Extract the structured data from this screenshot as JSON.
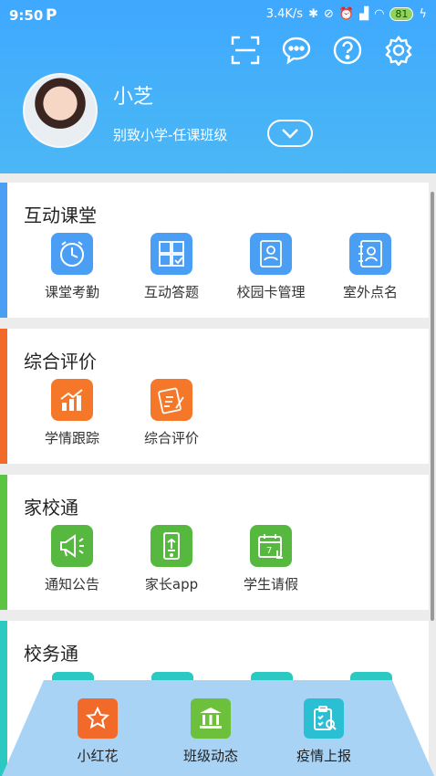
{
  "status": {
    "time": "9:50",
    "p_icon": "P",
    "net_speed": "3.4K/s",
    "battery": "81"
  },
  "header": {
    "icons": [
      "scan-icon",
      "message-icon",
      "help-icon",
      "settings-icon"
    ],
    "user_name": "小芝",
    "school_class": "别致小学-任课班级"
  },
  "sections": [
    {
      "title": "互动课堂",
      "accent": "#4a9ff5",
      "items": [
        {
          "label": "课堂考勤",
          "icon": "clock-icon",
          "color": "#4a9ff5"
        },
        {
          "label": "互动答题",
          "icon": "quiz-icon",
          "color": "#4a9ff5"
        },
        {
          "label": "校园卡管理",
          "icon": "id-card-icon",
          "color": "#4a9ff5"
        },
        {
          "label": "室外点名",
          "icon": "contact-book-icon",
          "color": "#4a9ff5"
        }
      ]
    },
    {
      "title": "综合评价",
      "accent": "#f26a2a",
      "items": [
        {
          "label": "学情跟踪",
          "icon": "chart-icon",
          "color": "#f5782a"
        },
        {
          "label": "综合评价",
          "icon": "evaluation-icon",
          "color": "#f5782a"
        }
      ]
    },
    {
      "title": "家校通",
      "accent": "#5cc443",
      "items": [
        {
          "label": "通知公告",
          "icon": "megaphone-icon",
          "color": "#56b83e"
        },
        {
          "label": "家长app",
          "icon": "phone-app-icon",
          "color": "#56b83e"
        },
        {
          "label": "学生请假",
          "icon": "calendar-icon",
          "color": "#56b83e"
        }
      ]
    },
    {
      "title": "校务通",
      "accent": "#2cc9c3"
    }
  ],
  "bottom_nav": [
    {
      "label": "小红花",
      "icon": "star-icon",
      "color": "#f26a2a"
    },
    {
      "label": "班级动态",
      "icon": "bank-icon",
      "color": "#6cc03c"
    },
    {
      "label": "疫情上报",
      "icon": "clipboard-icon",
      "color": "#2bbfd4"
    }
  ]
}
